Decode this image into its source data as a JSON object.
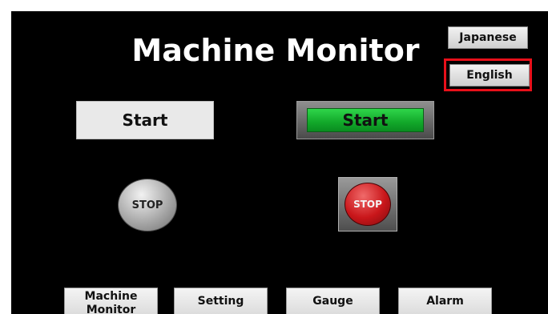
{
  "header": {
    "title": "Machine Monitor"
  },
  "language": {
    "japanese_label": "Japanese",
    "english_label": "English",
    "selected": "English",
    "highlight_color": "#e8101a"
  },
  "controls": {
    "start_plain_label": "Start",
    "start_lamp_label": "Start",
    "stop_round_label": "STOP",
    "stop_lamp_label": "STOP",
    "lamp_green": "#12a82a",
    "lamp_red": "#c9161a"
  },
  "nav": {
    "items": [
      {
        "label": "Machine Monitor"
      },
      {
        "label": "Setting"
      },
      {
        "label": "Gauge"
      },
      {
        "label": "Alarm"
      }
    ]
  }
}
